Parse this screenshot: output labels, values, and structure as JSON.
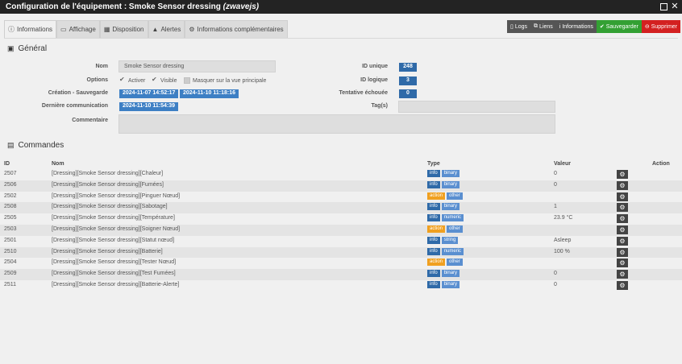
{
  "window": {
    "title_prefix": "Configuration de l'équipement : Smoke Sensor dressing",
    "title_plugin": "(zwavejs)"
  },
  "tabs": [
    {
      "label": "Informations",
      "icon": "info-circle-icon",
      "glyph": "ⓘ"
    },
    {
      "label": "Affichage",
      "icon": "desktop-icon",
      "glyph": "▭"
    },
    {
      "label": "Disposition",
      "icon": "grid-icon",
      "glyph": "▦"
    },
    {
      "label": "Alertes",
      "icon": "warning-icon",
      "glyph": "▲"
    },
    {
      "label": "Informations complémentaires",
      "icon": "cogs-icon",
      "glyph": "⚙"
    }
  ],
  "actions": [
    {
      "label": "Logs",
      "icon": "file-icon",
      "glyph": "▯",
      "color": "#555555"
    },
    {
      "label": "Liens",
      "icon": "sitemap-icon",
      "glyph": "⧉",
      "color": "#555555"
    },
    {
      "label": "Informations",
      "icon": "info-icon",
      "glyph": "i",
      "color": "#555555"
    },
    {
      "label": "Sauvegarder",
      "icon": "check-circle-icon",
      "glyph": "✔",
      "color": "#33a033"
    },
    {
      "label": "Supprimer",
      "icon": "minus-circle-icon",
      "glyph": "⊖",
      "color": "#d32020"
    }
  ],
  "general": {
    "section_title": "Général",
    "name_label": "Nom",
    "name_value": "Smoke Sensor dressing",
    "options_label": "Options",
    "opt_active": "Activer",
    "opt_visible": "Visible",
    "opt_hide": "Masquer sur la vue principale",
    "created_label": "Création - Sauvegarde",
    "created_value": "2024-11-07 14:52:17",
    "saved_value": "2024-11-10 11:18:16",
    "dash": "-",
    "lastcomm_label": "Dernière communication",
    "lastcomm_value": "2024-11-10 11:54:39",
    "comment_label": "Commentaire",
    "uid_label": "ID unique",
    "uid_value": "248",
    "lid_label": "ID logique",
    "lid_value": "3",
    "failed_label": "Tentative échouée",
    "failed_value": "0",
    "tags_label": "Tag(s)"
  },
  "commands": {
    "section_title": "Commandes",
    "headers": {
      "id": "ID",
      "name": "Nom",
      "type": "Type",
      "value": "Valeur",
      "action": "Action"
    },
    "rows": [
      {
        "id": "2507",
        "name": "[Dressing][Smoke Sensor dressing][Chaleur]",
        "type": "info",
        "subtype": "binary",
        "value": "0"
      },
      {
        "id": "2506",
        "name": "[Dressing][Smoke Sensor dressing][Fumées]",
        "type": "info",
        "subtype": "binary",
        "value": "0"
      },
      {
        "id": "2502",
        "name": "[Dressing][Smoke Sensor dressing][Pinguer Nœud]",
        "type": "action",
        "subtype": "other",
        "value": ""
      },
      {
        "id": "2508",
        "name": "[Dressing][Smoke Sensor dressing][Sabotage]",
        "type": "info",
        "subtype": "binary",
        "value": "1"
      },
      {
        "id": "2505",
        "name": "[Dressing][Smoke Sensor dressing][Température]",
        "type": "info",
        "subtype": "numeric",
        "value": "23.9 °C"
      },
      {
        "id": "2503",
        "name": "[Dressing][Smoke Sensor dressing][Soigner Nœud]",
        "type": "action",
        "subtype": "other",
        "value": ""
      },
      {
        "id": "2501",
        "name": "[Dressing][Smoke Sensor dressing][Statut nœud]",
        "type": "info",
        "subtype": "string",
        "value": "Asleep"
      },
      {
        "id": "2510",
        "name": "[Dressing][Smoke Sensor dressing][Batterie]",
        "type": "info",
        "subtype": "numeric",
        "value": "100 %"
      },
      {
        "id": "2504",
        "name": "[Dressing][Smoke Sensor dressing][Tester Nœud]",
        "type": "action",
        "subtype": "other",
        "value": ""
      },
      {
        "id": "2509",
        "name": "[Dressing][Smoke Sensor dressing][Test Fumées]",
        "type": "info",
        "subtype": "binary",
        "value": "0"
      },
      {
        "id": "2511",
        "name": "[Dressing][Smoke Sensor dressing][Batterie-Alerte]",
        "type": "info",
        "subtype": "binary",
        "value": "0"
      }
    ]
  }
}
